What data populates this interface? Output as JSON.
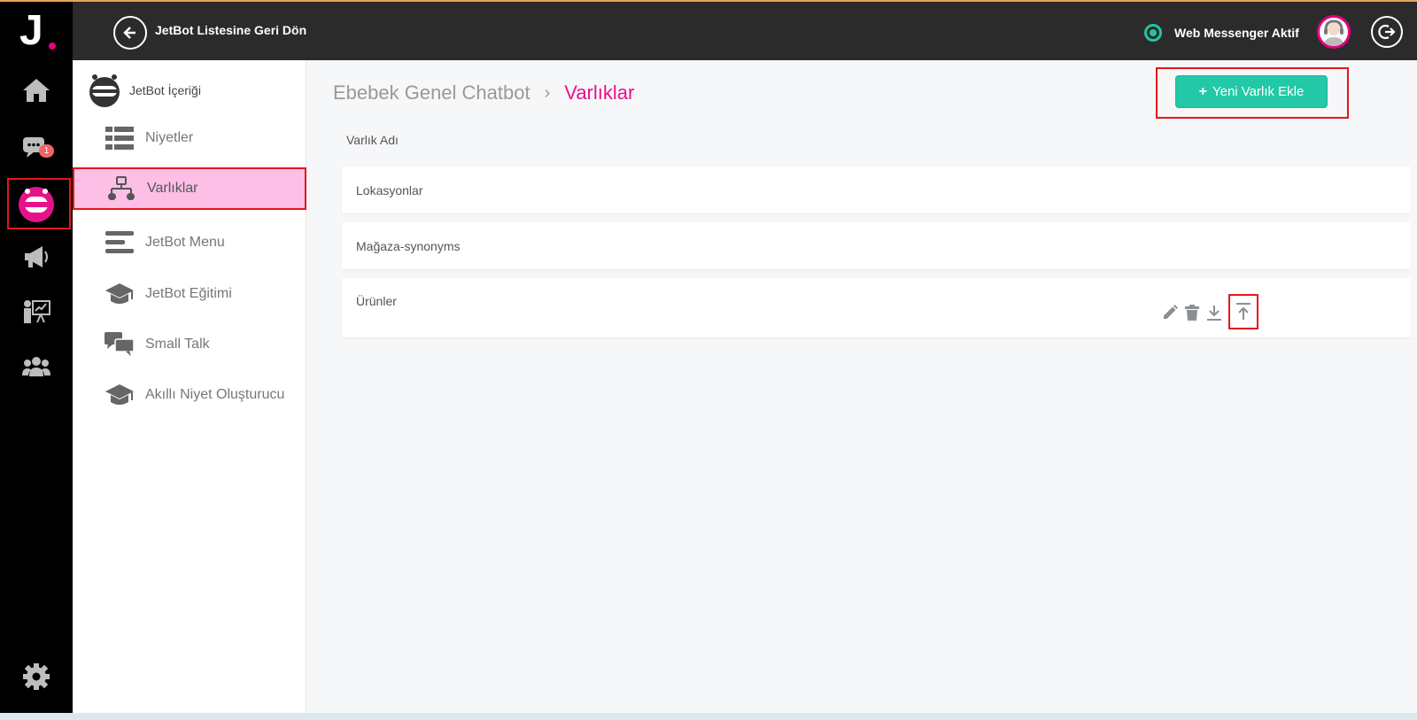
{
  "header": {
    "back_label": "JetBot Listesine Geri Dön",
    "status_label": "Web Messenger Aktif"
  },
  "rail": {
    "logo": "J",
    "chat_badge": "1",
    "icons": [
      "home-icon",
      "chat-icon",
      "bot-icon",
      "megaphone-icon",
      "training-icon",
      "users-icon",
      "gear-icon"
    ]
  },
  "subnav": {
    "title": "JetBot İçeriği",
    "items": [
      {
        "label": "Niyetler",
        "icon": "list-icon"
      },
      {
        "label": "Varlıklar",
        "icon": "hierarchy-icon",
        "active": true
      },
      {
        "label": "JetBot Menu",
        "icon": "menu-icon"
      },
      {
        "label": "JetBot Eğitimi",
        "icon": "graduation-cap-icon"
      },
      {
        "label": "Small Talk",
        "icon": "chat-bubbles-icon"
      },
      {
        "label": "Akıllı Niyet Oluşturucu",
        "icon": "graduation-cap-icon"
      }
    ]
  },
  "main": {
    "breadcrumb": {
      "parent": "Ebebek Genel Chatbot",
      "current": "Varlıklar"
    },
    "add_button": "Yeni Varlık Ekle",
    "column_header": "Varlık Adı",
    "rows": [
      {
        "name": "Lokasyonlar"
      },
      {
        "name": "Mağaza-synonyms"
      },
      {
        "name": "Ürünler"
      }
    ]
  },
  "colors": {
    "accent_pink": "#e5138a",
    "accent_green": "#23c8a6",
    "highlight_red": "#e4161c",
    "active_bg": "#fdbfe6"
  }
}
